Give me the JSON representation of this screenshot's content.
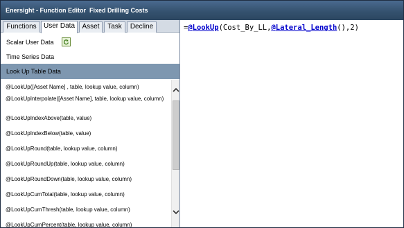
{
  "window": {
    "title": "Enersight - Function Editor  Fixed Drilling Costs"
  },
  "tabs": [
    {
      "label": "Functions",
      "active": false
    },
    {
      "label": "User Data",
      "active": true
    },
    {
      "label": "Asset",
      "active": false
    },
    {
      "label": "Task",
      "active": false
    },
    {
      "label": "Decline",
      "active": false
    }
  ],
  "categories": [
    {
      "label": "Scalar User Data",
      "icon": "refresh-icon",
      "selected": false
    },
    {
      "label": "Time Series Data",
      "selected": false
    },
    {
      "label": "Look Up Table Data",
      "selected": true
    }
  ],
  "functions": [
    "@LookUp([Asset Name] , table, lookup value, column)",
    "@LookUpInterpolate([Asset Name], table, lookup value, column)",
    "@LookUpIndexAbove(table, value)",
    "@LookUpIndexBelow(table, value)",
    "@LookUpRound(table, lookup value, column)",
    "@LookUpRoundUp(table, lookup value, column)",
    "@LookUpRoundDown(table, lookup value, column)",
    "@LookUpCumTotal(table, lookup value, column)",
    "@LookUpCumThresh(table, lookup value, column)",
    "@LookUpCumPercent(table, lookup value, column)"
  ],
  "editor": {
    "formula_parts": [
      "=",
      "@LookUp",
      "(Cost_By_LL,",
      "@Lateral_Length",
      "(),2)"
    ]
  },
  "colors": {
    "titlebar": "#35526f",
    "selected_category": "#7e97b0",
    "function_token": "#0000cc"
  }
}
